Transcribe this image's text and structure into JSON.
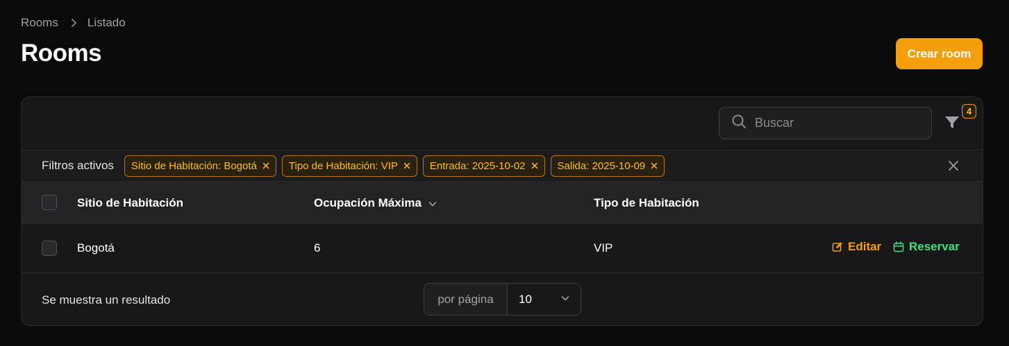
{
  "breadcrumb": {
    "parent": "Rooms",
    "current": "Listado"
  },
  "page_title": "Rooms",
  "create_button": "Crear room",
  "search": {
    "placeholder": "Buscar",
    "value": ""
  },
  "filter_count": "4",
  "active_filters": {
    "label": "Filtros activos",
    "chips": [
      "Sitio de Habitación: Bogotá",
      "Tipo de Habitación: VIP",
      "Entrada: 2025-10-02",
      "Salida: 2025-10-09"
    ]
  },
  "table": {
    "columns": [
      "Sitio de Habitación",
      "Ocupación Máxima",
      "Tipo de Habitación"
    ],
    "rows": [
      {
        "sitio": "Bogotá",
        "ocupacion": "6",
        "tipo": "VIP"
      }
    ],
    "actions": {
      "edit": "Editar",
      "reserve": "Reservar"
    }
  },
  "footer": {
    "result_text": "Se muestra un resultado",
    "per_page_label": "por página",
    "per_page_value": "10"
  },
  "colors": {
    "accent": "#f59e0b",
    "reserve": "#4ade80",
    "background": "#0a0a0b",
    "card": "#18181b"
  }
}
